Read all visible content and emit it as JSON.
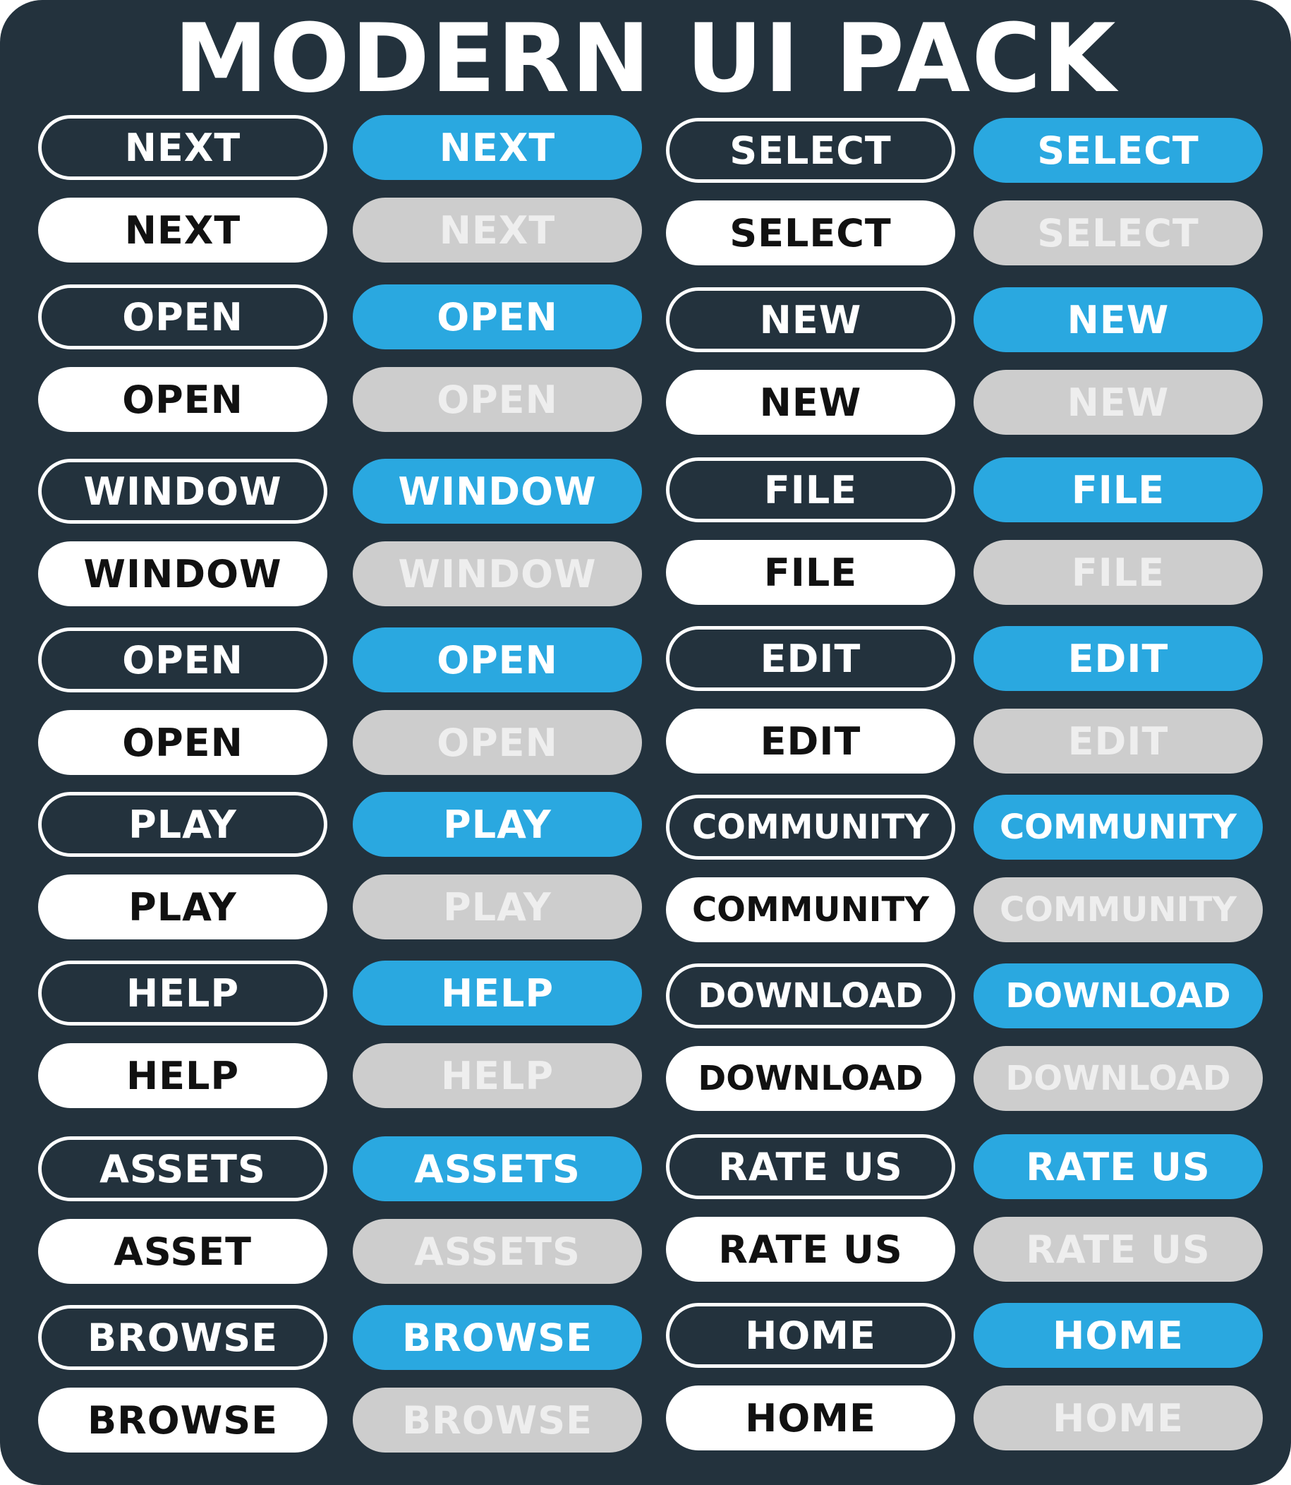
{
  "title": "MODERN UI PACK",
  "colors": {
    "background": "#23323d",
    "primary": "#2aa8e0",
    "disabled": "#cdcdcd",
    "solid": "#ffffff"
  },
  "groups": [
    {
      "left": {
        "outline": "NEXT",
        "primary": "NEXT",
        "solid": "NEXT",
        "disabled": "NEXT"
      },
      "right": {
        "outline": "SELECT",
        "primary": "SELECT",
        "solid": "SELECT",
        "disabled": "SELECT"
      }
    },
    {
      "left": {
        "outline": "OPEN",
        "primary": "OPEN",
        "solid": "OPEN",
        "disabled": "OPEN"
      },
      "right": {
        "outline": "NEW",
        "primary": "NEW",
        "solid": "NEW",
        "disabled": "NEW"
      }
    },
    {
      "left": {
        "outline": "WINDOW",
        "primary": "WINDOW",
        "solid": "WINDOW",
        "disabled": "WINDOW"
      },
      "right": {
        "outline": "FILE",
        "primary": "FILE",
        "solid": "FILE",
        "disabled": "FILE"
      }
    },
    {
      "left": {
        "outline": "OPEN",
        "primary": "OPEN",
        "solid": "OPEN",
        "disabled": "OPEN"
      },
      "right": {
        "outline": "EDIT",
        "primary": "EDIT",
        "solid": "EDIT",
        "disabled": "EDIT"
      }
    },
    {
      "left": {
        "outline": "PLAY",
        "primary": "PLAY",
        "solid": "PLAY",
        "disabled": "PLAY"
      },
      "right": {
        "outline": "COMMUNITY",
        "primary": "COMMUNITY",
        "solid": "COMMUNITY",
        "disabled": "COMMUNITY"
      }
    },
    {
      "left": {
        "outline": "HELP",
        "primary": "HELP",
        "solid": "HELP",
        "disabled": "HELP"
      },
      "right": {
        "outline": "DOWNLOAD",
        "primary": "DOWNLOAD",
        "solid": "DOWNLOAD",
        "disabled": "DOWNLOAD"
      }
    },
    {
      "left": {
        "outline": "ASSETS",
        "primary": "ASSETS",
        "solid": "ASSET",
        "disabled": "ASSETS"
      },
      "right": {
        "outline": "RATE US",
        "primary": "RATE US",
        "solid": "RATE US",
        "disabled": "RATE US"
      }
    },
    {
      "left": {
        "outline": "BROWSE",
        "primary": "BROWSE",
        "solid": "BROWSE",
        "disabled": "BROWSE"
      },
      "right": {
        "outline": "HOME",
        "primary": "HOME",
        "solid": "HOME",
        "disabled": "HOME"
      }
    }
  ]
}
